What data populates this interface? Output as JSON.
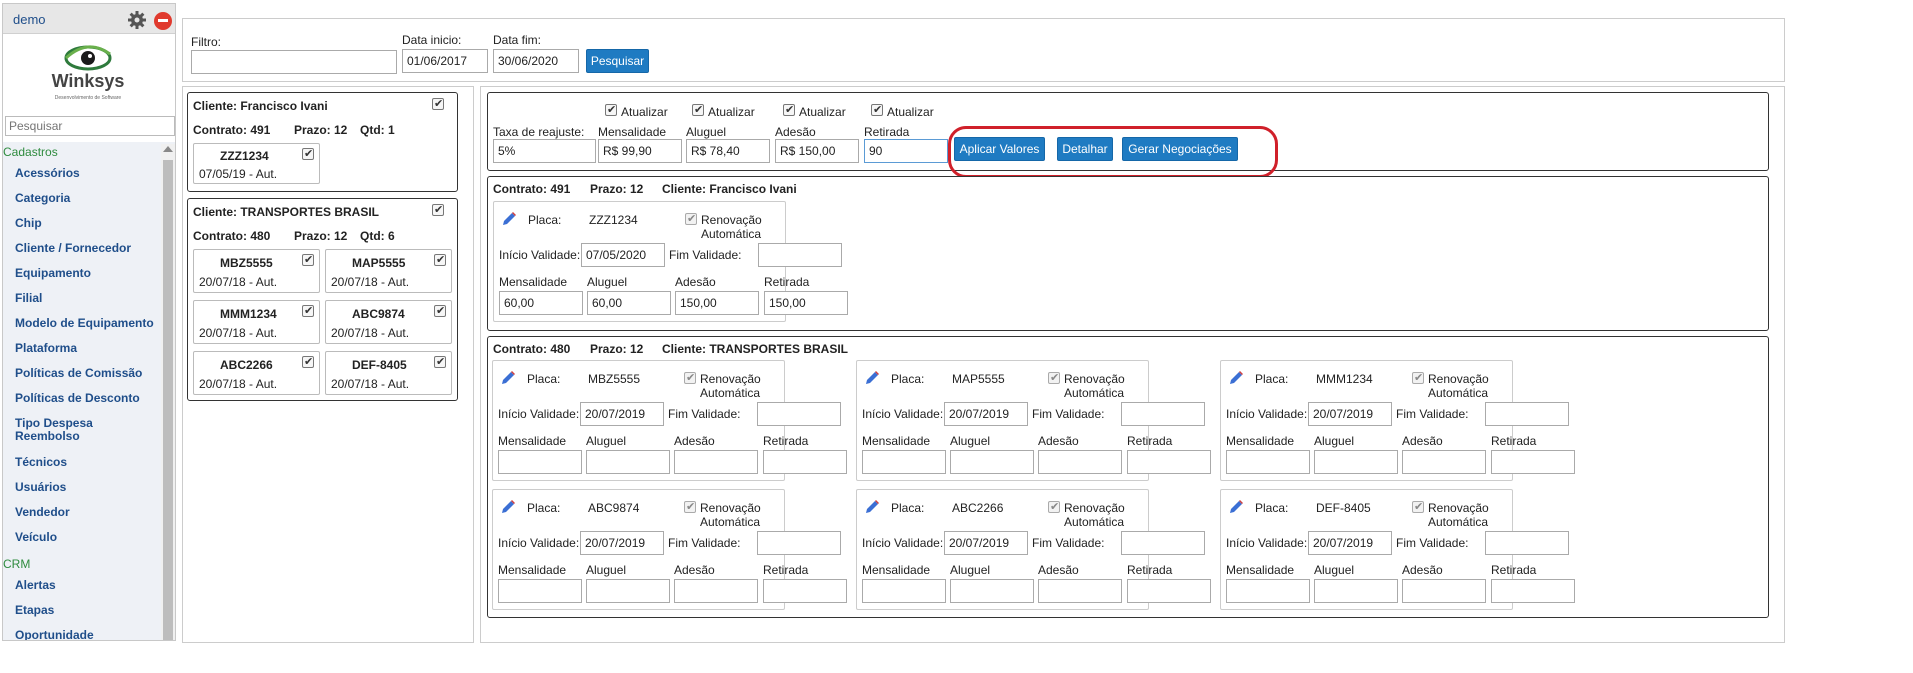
{
  "sidebar": {
    "user": "demo",
    "logo": {
      "brand": "Winksys",
      "tagline": "Desenvolvimento de Software"
    },
    "search_placeholder": "Pesquisar",
    "groups": [
      {
        "label": "Cadastros",
        "items": [
          "Acessórios",
          "Categoria",
          "Chip",
          "Cliente / Fornecedor",
          "Equipamento",
          "Filial",
          "Modelo de Equipamento",
          "Plataforma",
          "Políticas de Comissão",
          "Políticas de Desconto",
          "Tipo Despesa Reembolso",
          "Técnicos",
          "Usuários",
          "Vendedor",
          "Veículo"
        ]
      },
      {
        "label": "CRM",
        "items": [
          "Alertas",
          "Etapas",
          "Oportunidade"
        ]
      }
    ],
    "icons": {
      "settings": "gear-icon",
      "logout": "stop-icon"
    }
  },
  "filter": {
    "filtro_label": "Filtro:",
    "filtro_value": "",
    "inicio_label": "Data inicio:",
    "inicio_value": "01/06/2017",
    "fim_label": "Data fim:",
    "fim_value": "30/06/2020",
    "search_button": "Pesquisar"
  },
  "clients": [
    {
      "cliente": "Cliente: Francisco Ivani",
      "contrato": "Contrato: 491",
      "prazo": "Prazo: 12",
      "qtd": "Qtd: 1",
      "vehicles": [
        {
          "placa": "ZZZ1234",
          "info": "07/05/19 - Aut."
        }
      ]
    },
    {
      "cliente": "Cliente: TRANSPORTES BRASIL",
      "contrato": "Contrato: 480",
      "prazo": "Prazo: 12",
      "qtd": "Qtd: 6",
      "vehicles": [
        {
          "placa": "MBZ5555",
          "info": "20/07/18 - Aut."
        },
        {
          "placa": "MAP5555",
          "info": "20/07/18 - Aut."
        },
        {
          "placa": "MMM1234",
          "info": "20/07/18 - Aut."
        },
        {
          "placa": "ABC9874",
          "info": "20/07/18 - Aut."
        },
        {
          "placa": "ABC2266",
          "info": "20/07/18 - Aut."
        },
        {
          "placa": "DEF-8405",
          "info": "20/07/18 - Aut."
        }
      ]
    }
  ],
  "adjust": {
    "atualizar": "Atualizar",
    "taxa_label": "Taxa de reajuste:",
    "taxa_value": "5%",
    "mensalidade_label": "Mensalidade",
    "mensalidade_value": "R$ 99,90",
    "aluguel_label": "Aluguel",
    "aluguel_value": "R$ 78,40",
    "adesao_label": "Adesão",
    "adesao_value": "R$ 150,00",
    "retirada_label": "Retirada",
    "retirada_value": "90",
    "buttons": {
      "aplicar": "Aplicar Valores",
      "detalhar": "Detalhar",
      "gerar": "Gerar Negociações"
    },
    "highlight_color": "#d0202a"
  },
  "labels": {
    "placa": "Placa:",
    "renovacao": "Renovação Automática",
    "inicio": "Início Validade:",
    "fim": "Fim Validade:",
    "mensalidade": "Mensalidade",
    "aluguel": "Aluguel",
    "adesao": "Adesão",
    "retirada": "Retirada"
  },
  "contracts": [
    {
      "contrato": "Contrato: 491",
      "prazo": "Prazo: 12",
      "cliente": "Cliente: Francisco Ivani",
      "plates": [
        {
          "placa": "ZZZ1234",
          "inicio": "07/05/2020",
          "fim": "",
          "mensalidade": "60,00",
          "aluguel": "60,00",
          "adesao": "150,00",
          "retirada": "150,00"
        }
      ]
    },
    {
      "contrato": "Contrato: 480",
      "prazo": "Prazo: 12",
      "cliente": "Cliente: TRANSPORTES BRASIL",
      "plates": [
        {
          "placa": "MBZ5555",
          "inicio": "20/07/2019",
          "fim": "",
          "mensalidade": "",
          "aluguel": "",
          "adesao": "",
          "retirada": ""
        },
        {
          "placa": "MAP5555",
          "inicio": "20/07/2019",
          "fim": "",
          "mensalidade": "",
          "aluguel": "",
          "adesao": "",
          "retirada": ""
        },
        {
          "placa": "MMM1234",
          "inicio": "20/07/2019",
          "fim": "",
          "mensalidade": "",
          "aluguel": "",
          "adesao": "",
          "retirada": ""
        },
        {
          "placa": "ABC9874",
          "inicio": "20/07/2019",
          "fim": "",
          "mensalidade": "",
          "aluguel": "",
          "adesao": "",
          "retirada": ""
        },
        {
          "placa": "ABC2266",
          "inicio": "20/07/2019",
          "fim": "",
          "mensalidade": "",
          "aluguel": "",
          "adesao": "",
          "retirada": ""
        },
        {
          "placa": "DEF-8405",
          "inicio": "20/07/2019",
          "fim": "",
          "mensalidade": "",
          "aluguel": "",
          "adesao": "",
          "retirada": ""
        }
      ]
    }
  ],
  "colors": {
    "accent_blue": "#1f7bc2",
    "link_blue": "#1f4e8a",
    "group_green": "#2e8b3e"
  }
}
